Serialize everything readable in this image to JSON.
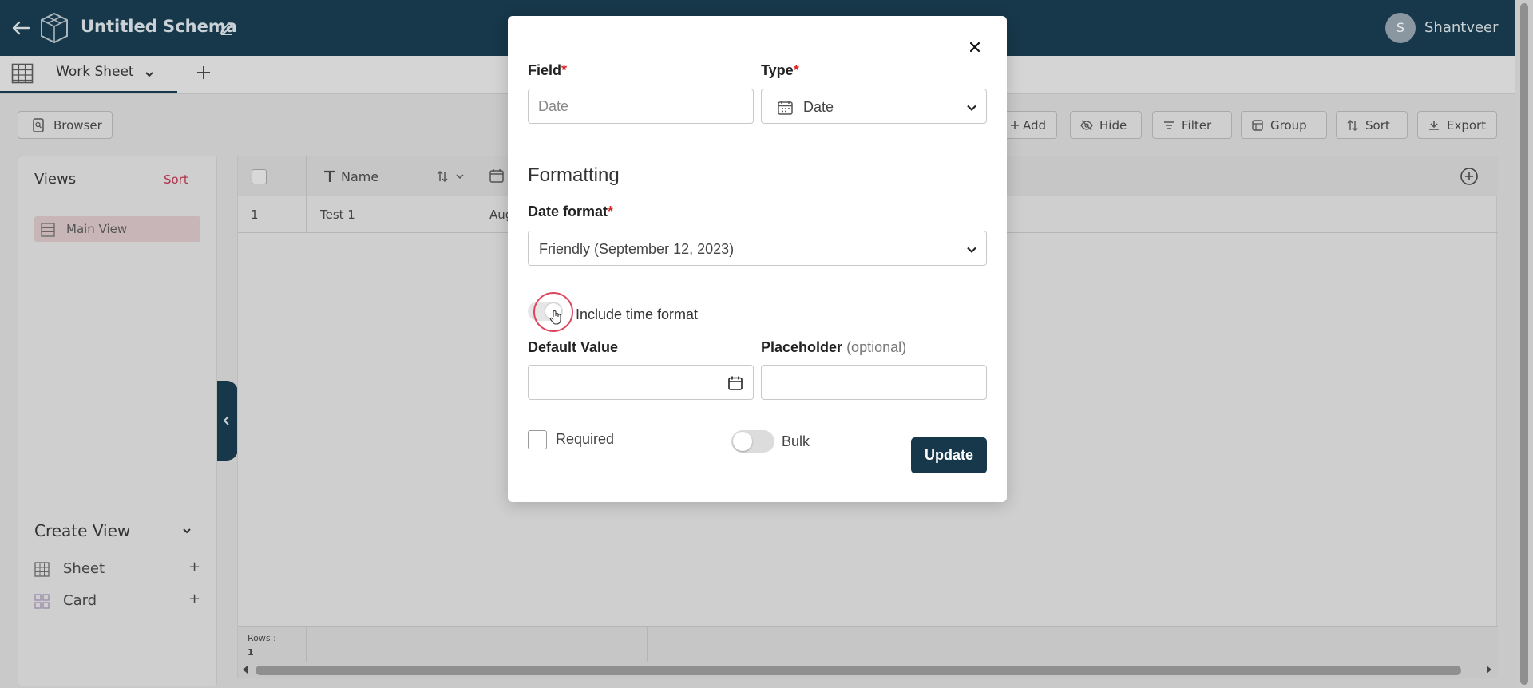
{
  "app": {
    "title": "Untitled Schema",
    "user_name": "Shantveer",
    "avatar_letter": "S"
  },
  "tabs": {
    "active_label": "Work Sheet"
  },
  "toolbar": {
    "browser": "Browser",
    "add": "Add",
    "hide": "Hide",
    "filter": "Filter",
    "group": "Group",
    "sort": "Sort",
    "export": "Export"
  },
  "sidebar": {
    "views_title": "Views",
    "views_sort": "Sort",
    "main_view": "Main View",
    "create_view": "Create View",
    "create_items": [
      {
        "label": "Sheet",
        "action": "+"
      },
      {
        "label": "Card",
        "action": "+"
      }
    ]
  },
  "grid": {
    "col_name": "Name",
    "rows": [
      {
        "num": "1",
        "name": "Test 1",
        "date": "Aug"
      }
    ],
    "footer_rows_label": "Rows :",
    "footer_rows_value": "1"
  },
  "modal": {
    "field_label": "Field",
    "field_value": "Date",
    "type_label": "Type",
    "type_value": "Date",
    "section_title": "Formatting",
    "date_format_label": "Date format",
    "date_format_value": "Friendly (September 12, 2023)",
    "include_time_label": "Include time format",
    "default_value_label": "Default Value",
    "placeholder_label": "Placeholder",
    "placeholder_optional": "(optional)",
    "required_label": "Required",
    "bulk_label": "Bulk",
    "update_button": "Update",
    "required_mark": "*"
  },
  "colors": {
    "primary": "#16384a",
    "accent_sort": "#b0304a",
    "required": "#dd2222",
    "click_ring": "#e0455c"
  }
}
